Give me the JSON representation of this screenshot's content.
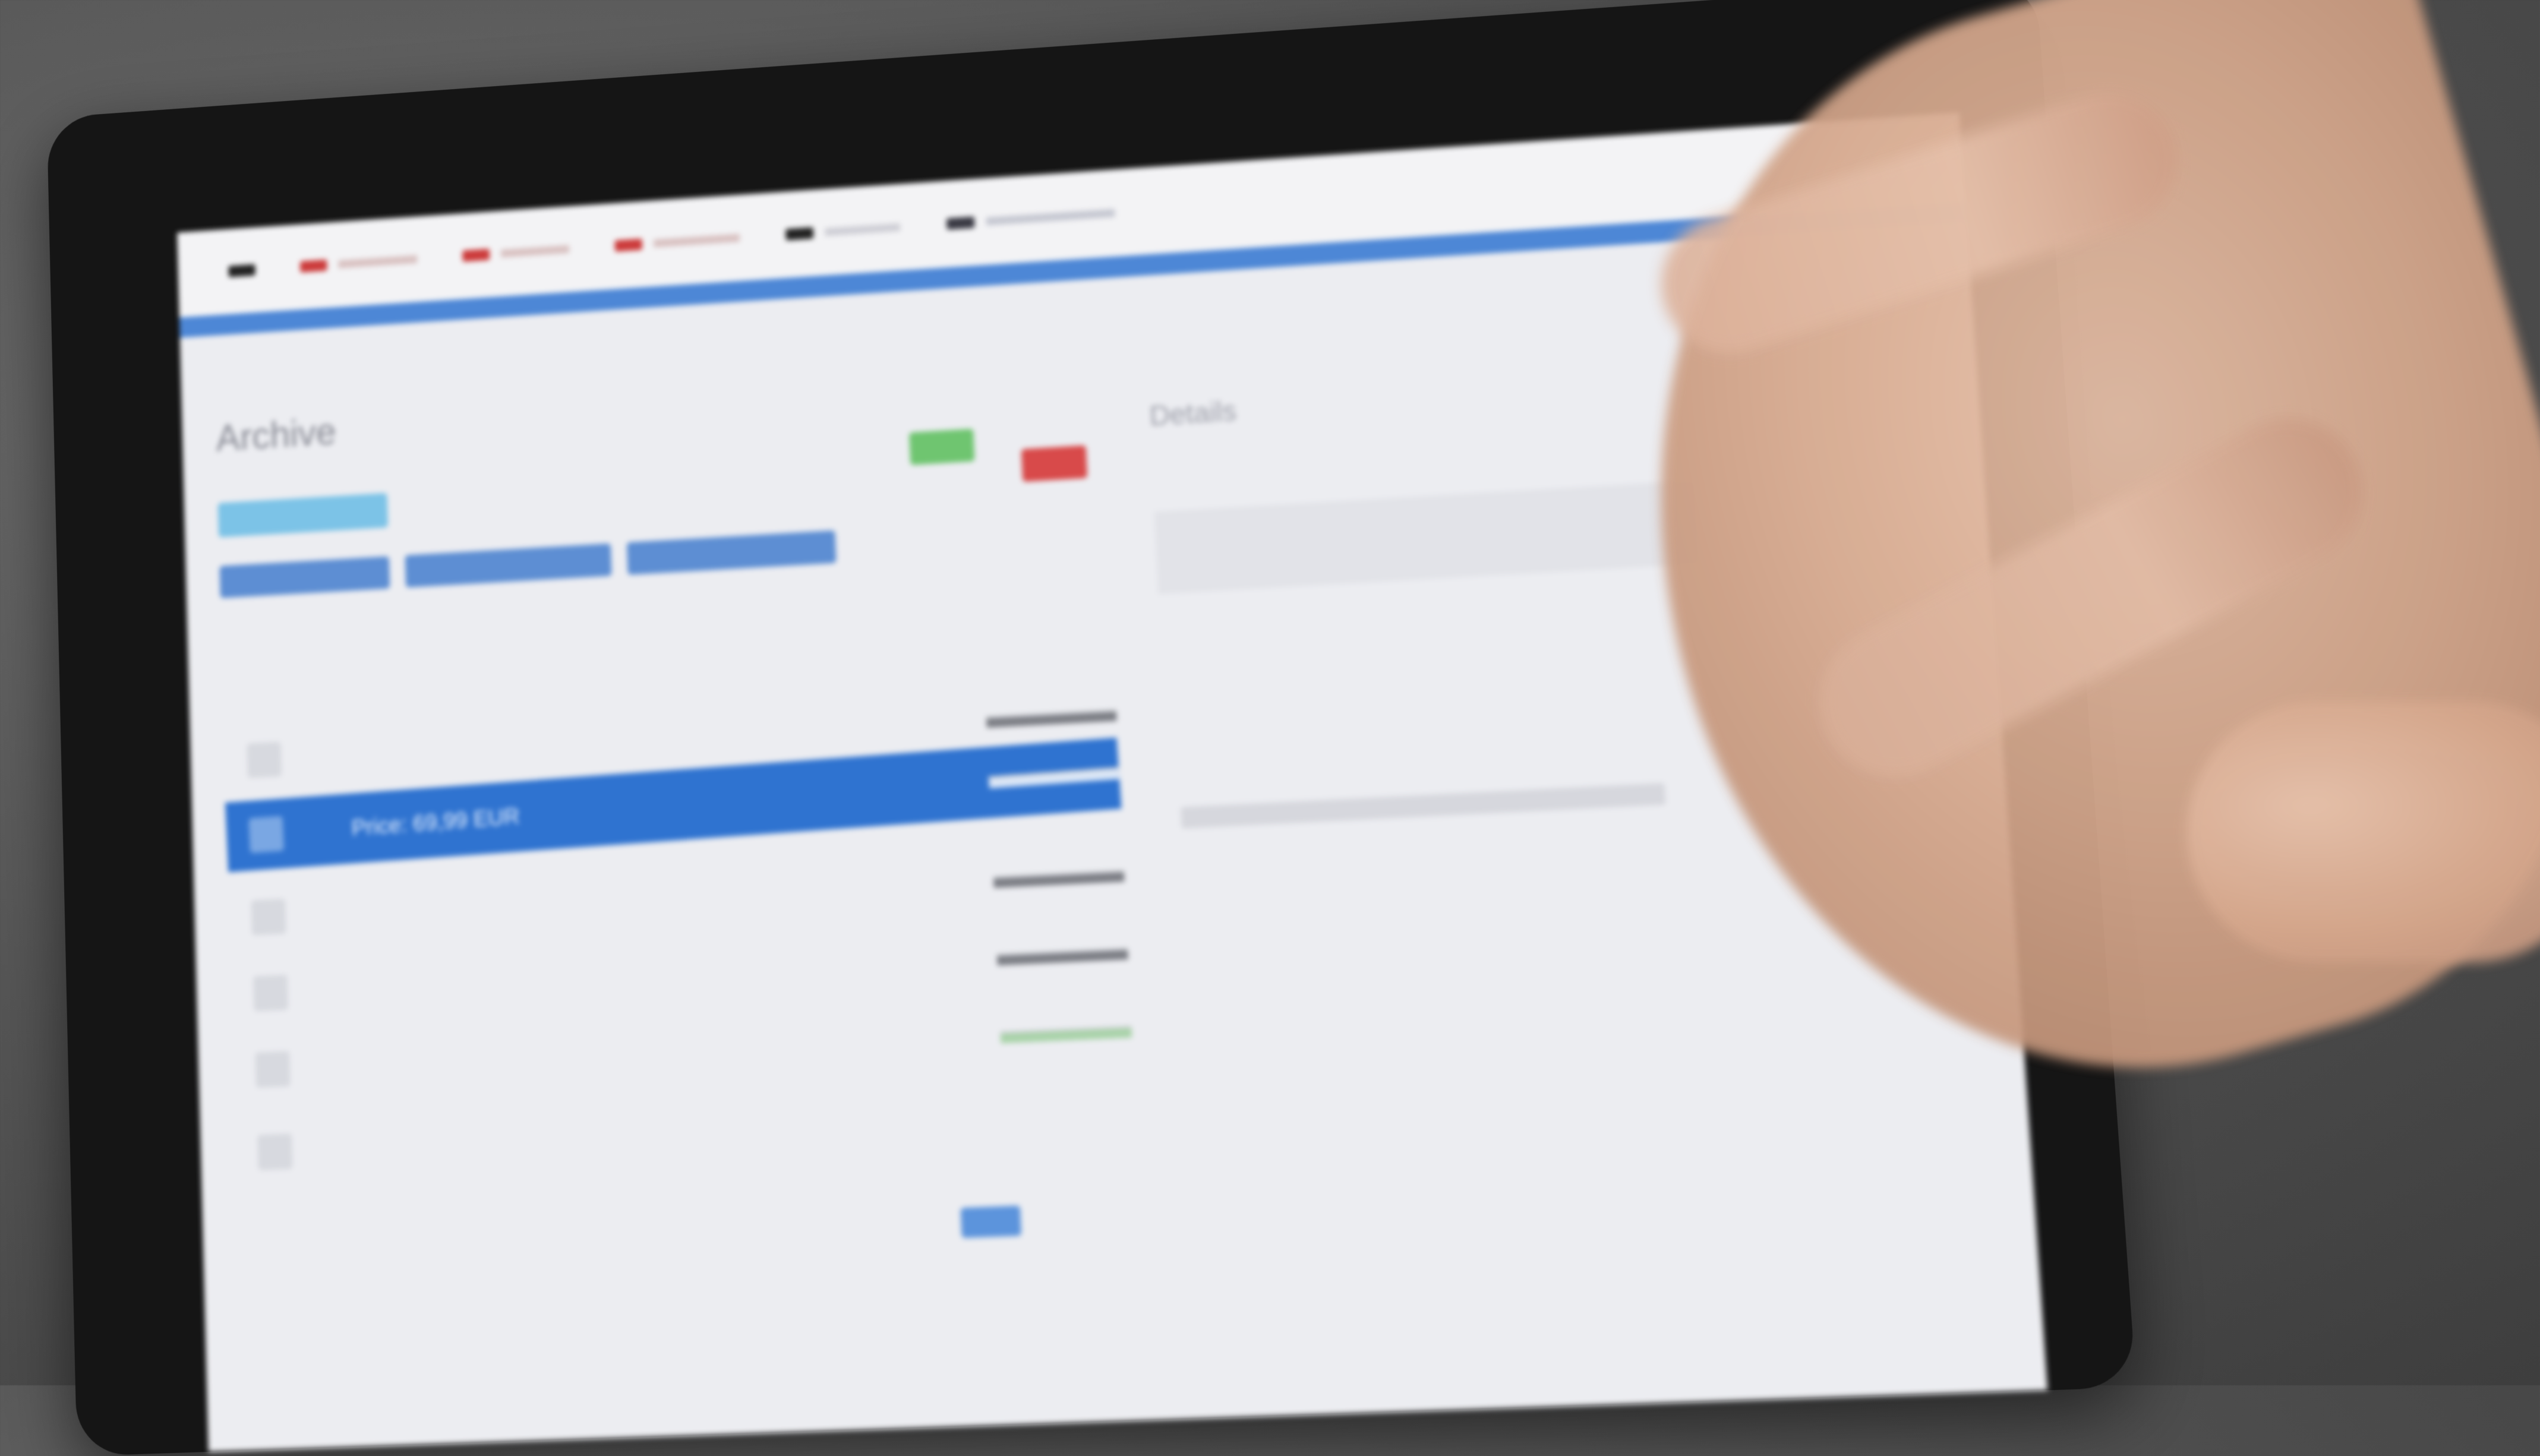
{
  "screen": {
    "page_title": "Archive",
    "buttons": {
      "primary": "",
      "row": [
        "",
        "",
        ""
      ],
      "accept": "",
      "reject": ""
    },
    "side_panel": {
      "title": "Details",
      "subtitle": "",
      "link": ""
    },
    "table": {
      "rows": [
        {
          "text": "",
          "col2": ""
        },
        {
          "text": "Price: 69,99 EUR",
          "col2": ""
        },
        {
          "text": "",
          "col2": ""
        },
        {
          "text": "",
          "col2": ""
        },
        {
          "text": "",
          "col2": ""
        },
        {
          "text": "",
          "col2": ""
        }
      ]
    }
  },
  "colors": {
    "topbar_accent": "#4d87d6",
    "selected_row": "#2f73d0",
    "accept_button": "#6fc570",
    "reject_button": "#d84a4a",
    "primary_button": "#7cc3e7"
  },
  "icons": {
    "nav_markers": [
      "dark-square-icon",
      "red-square-icon",
      "red-square-icon",
      "red-square-icon",
      "dark-square-icon",
      "dark-square-icon"
    ]
  }
}
